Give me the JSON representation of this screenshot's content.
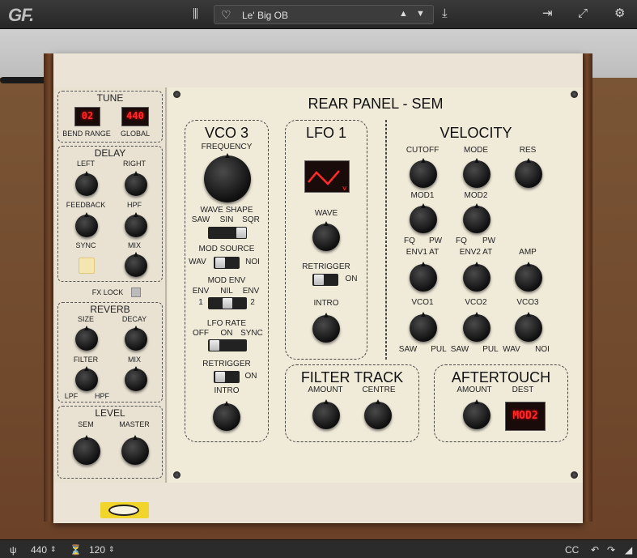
{
  "app": {
    "logo": "GF.",
    "preset_name": "Le' Big OB"
  },
  "topbar_icons": {
    "library": "library-icon",
    "favorite": "heart-icon",
    "prev": "arrow-up-icon",
    "next": "arrow-down-icon",
    "save": "download-icon",
    "load": "import-icon",
    "expand": "expand-icon",
    "settings": "gear-icon"
  },
  "panel": {
    "title": "REAR PANEL - SEM"
  },
  "tune": {
    "title": "TUNE",
    "bend_value": "02",
    "bend_label": "BEND RANGE",
    "global_value": "440",
    "global_label": "GLOBAL"
  },
  "delay": {
    "title": "DELAY",
    "left": "LEFT",
    "right": "RIGHT",
    "feedback": "FEEDBACK",
    "hpf": "HPF",
    "sync": "SYNC",
    "mix": "MIX"
  },
  "fxlock": "FX LOCK",
  "reverb": {
    "title": "REVERB",
    "size": "SIZE",
    "decay": "DECAY",
    "filter": "FILTER",
    "mix": "MIX",
    "lpf": "LPF",
    "hpf": "HPF"
  },
  "level": {
    "title": "LEVEL",
    "sem": "SEM",
    "master": "MASTER"
  },
  "vco3": {
    "title": "VCO 3",
    "frequency": "FREQUENCY",
    "wave_shape": "WAVE SHAPE",
    "saw": "SAW",
    "sin": "SIN",
    "sqr": "SQR",
    "mod_source": "MOD SOURCE",
    "wav": "WAV",
    "noi": "NOI",
    "mod_env": "MOD ENV",
    "env": "ENV",
    "nil": "NIL",
    "env2": "ENV",
    "one": "1",
    "two": "2",
    "lfo_rate": "LFO RATE",
    "off": "OFF",
    "on": "ON",
    "sync": "SYNC",
    "retrigger": "RETRIGGER",
    "retrig_on": "ON",
    "intro": "INTRO"
  },
  "lfo1": {
    "title": "LFO 1",
    "wave": "WAVE",
    "retrigger": "RETRIGGER",
    "on": "ON",
    "intro": "INTRO"
  },
  "velocity": {
    "title": "VELOCITY",
    "cutoff": "CUTOFF",
    "mode": "MODE",
    "res": "RES",
    "mod1": "MOD1",
    "mod2": "MOD2",
    "fq1": "FQ",
    "pw1": "PW",
    "fq2": "FQ",
    "pw2": "PW",
    "env1at": "ENV1 AT",
    "env2at": "ENV2 AT",
    "amp": "AMP",
    "vco1": "VCO1",
    "vco2": "VCO2",
    "vco3": "VCO3",
    "saw1": "SAW",
    "pul1": "PUL",
    "saw2": "SAW",
    "pul2": "PUL",
    "wav3": "WAV",
    "noi3": "NOI"
  },
  "filter_track": {
    "title": "FILTER TRACK",
    "amount": "AMOUNT",
    "centre": "CENTRE"
  },
  "aftertouch": {
    "title": "AFTERTOUCH",
    "amount": "AMOUNT",
    "dest": "DEST",
    "dest_value": "MOD2"
  },
  "bottombar": {
    "tuning": "440",
    "tempo": "120",
    "cc": "CC"
  }
}
